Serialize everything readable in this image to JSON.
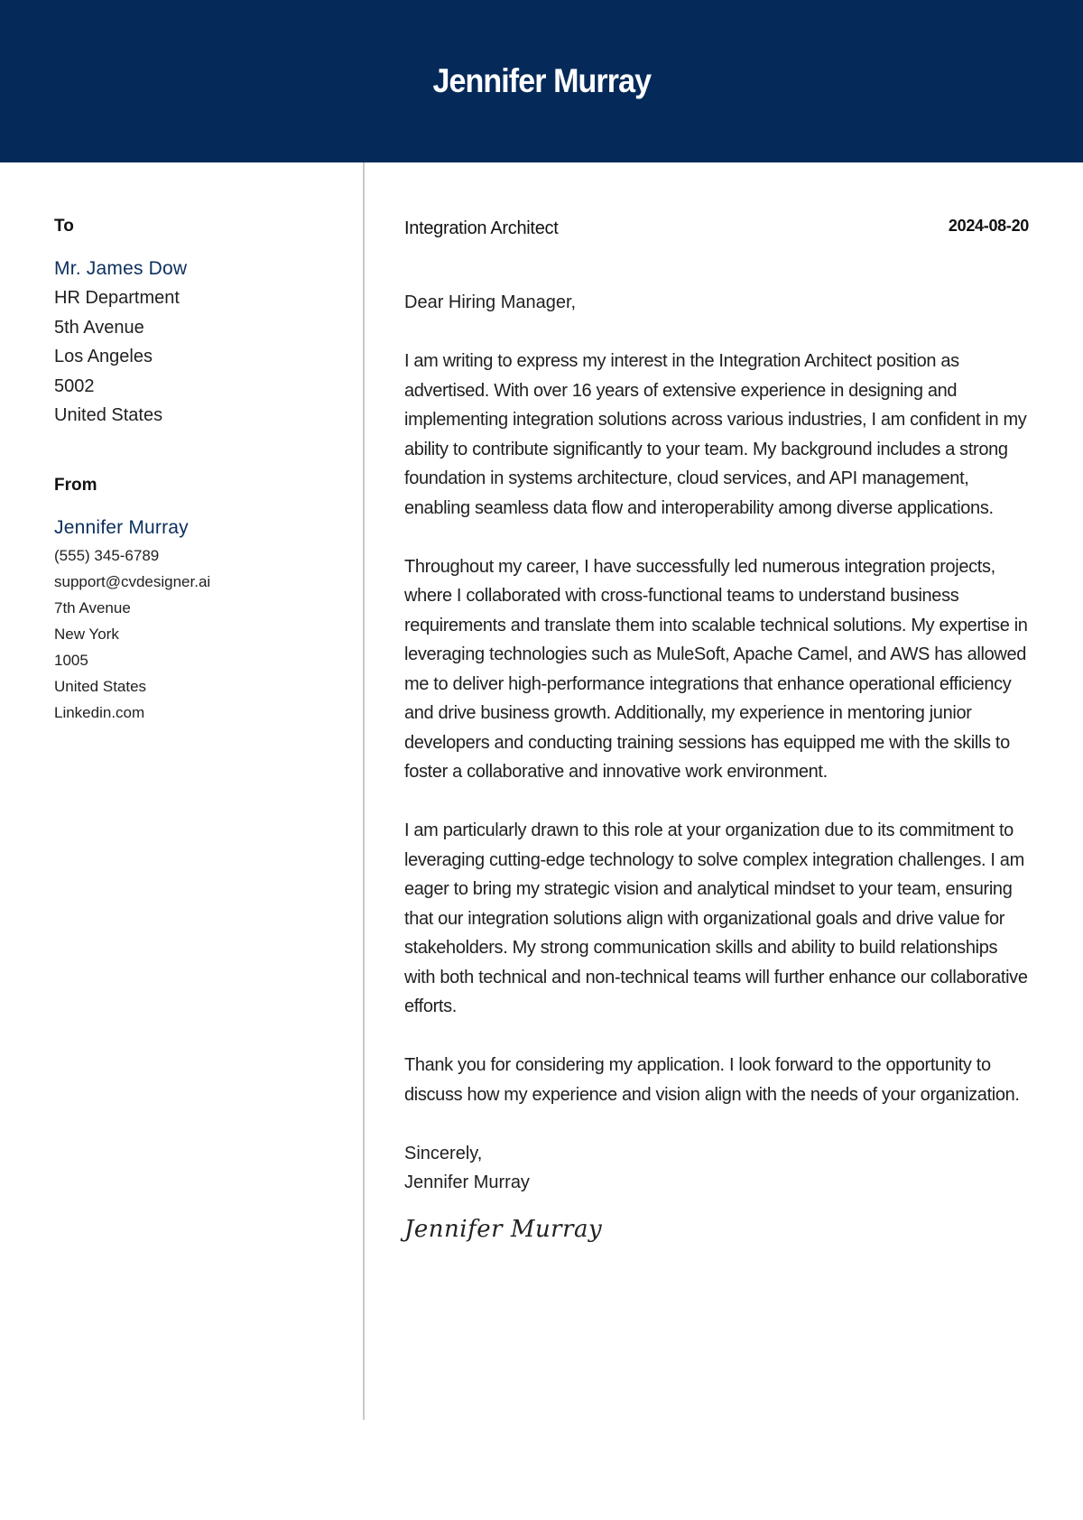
{
  "header": {
    "name": "Jennifer Murray"
  },
  "sidebar": {
    "to_label": "To",
    "recipient": {
      "name": "Mr. James Dow",
      "lines": [
        "HR Department",
        "5th Avenue",
        "Los Angeles",
        "5002",
        "United States"
      ]
    },
    "from_label": "From",
    "sender": {
      "name": "Jennifer Murray",
      "phone": "(555) 345-6789",
      "email": "support@cvdesigner.ai",
      "street": "7th Avenue",
      "city": "New York",
      "zip": "1005",
      "country": "United States",
      "website": "Linkedin.com"
    }
  },
  "letter": {
    "job_title": "Integration Architect",
    "date": "2024-08-20",
    "salutation": "Dear Hiring Manager,",
    "paragraphs": [
      "I am writing to express my interest in the Integration Architect position as advertised. With over 16 years of extensive experience in designing and implementing integration solutions across various industries, I am confident in my ability to contribute significantly to your team. My background includes a strong foundation in systems architecture, cloud services, and API management, enabling seamless data flow and interoperability among diverse applications.",
      "Throughout my career, I have successfully led numerous integration projects, where I collaborated with cross-functional teams to understand business requirements and translate them into scalable technical solutions. My expertise in leveraging technologies such as MuleSoft, Apache Camel, and AWS has allowed me to deliver high-performance integrations that enhance operational efficiency and drive business growth. Additionally, my experience in mentoring junior developers and conducting training sessions has equipped me with the skills to foster a collaborative and innovative work environment.",
      "I am particularly drawn to this role at your organization due to its commitment to leveraging cutting-edge technology to solve complex integration challenges. I am eager to bring my strategic vision and analytical mindset to your team, ensuring that our integration solutions align with organizational goals and drive value for stakeholders. My strong communication skills and ability to build relationships with both technical and non-technical teams will further enhance our collaborative efforts.",
      "Thank you for considering my application. I look forward to the opportunity to discuss how my experience and vision align with the needs of your organization."
    ],
    "closing": "Sincerely,",
    "closing_name": "Jennifer Murray",
    "signature": "Jennifer Murray"
  },
  "colors": {
    "header_bg": "#052a5a",
    "accent_name": "#0c2f5e",
    "divider": "#c8c8c8"
  }
}
